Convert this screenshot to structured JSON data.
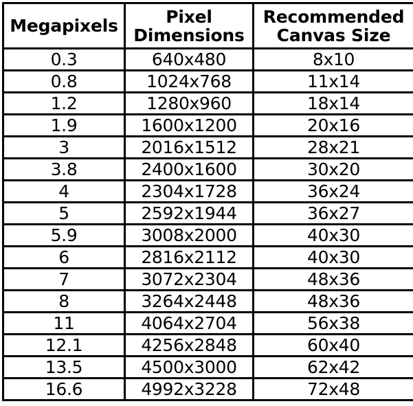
{
  "table": {
    "columns": [
      {
        "key": "megapixels",
        "lines": [
          "Megapixels"
        ]
      },
      {
        "key": "pixel_dimensions",
        "lines": [
          "Pixel",
          "Dimensions"
        ]
      },
      {
        "key": "canvas_size",
        "lines": [
          "Recommended",
          "Canvas Size"
        ]
      }
    ],
    "rows": [
      {
        "megapixels": "0.3",
        "pixel_dimensions": "640x480",
        "canvas_size": "8x10"
      },
      {
        "megapixels": "0.8",
        "pixel_dimensions": "1024x768",
        "canvas_size": "11x14"
      },
      {
        "megapixels": "1.2",
        "pixel_dimensions": "1280x960",
        "canvas_size": "18x14"
      },
      {
        "megapixels": "1.9",
        "pixel_dimensions": "1600x1200",
        "canvas_size": "20x16"
      },
      {
        "megapixels": "3",
        "pixel_dimensions": "2016x1512",
        "canvas_size": "28x21"
      },
      {
        "megapixels": "3.8",
        "pixel_dimensions": "2400x1600",
        "canvas_size": "30x20"
      },
      {
        "megapixels": "4",
        "pixel_dimensions": "2304x1728",
        "canvas_size": "36x24"
      },
      {
        "megapixels": "5",
        "pixel_dimensions": "2592x1944",
        "canvas_size": "36x27"
      },
      {
        "megapixels": "5.9",
        "pixel_dimensions": "3008x2000",
        "canvas_size": "40x30"
      },
      {
        "megapixels": "6",
        "pixel_dimensions": "2816x2112",
        "canvas_size": "40x30"
      },
      {
        "megapixels": "7",
        "pixel_dimensions": "3072x2304",
        "canvas_size": "48x36"
      },
      {
        "megapixels": "8",
        "pixel_dimensions": "3264x2448",
        "canvas_size": "48x36"
      },
      {
        "megapixels": "11",
        "pixel_dimensions": "4064x2704",
        "canvas_size": "56x38"
      },
      {
        "megapixels": "12.1",
        "pixel_dimensions": "4256x2848",
        "canvas_size": "60x40"
      },
      {
        "megapixels": "13.5",
        "pixel_dimensions": "4500x3000",
        "canvas_size": "62x42"
      },
      {
        "megapixels": "16.6",
        "pixel_dimensions": "4992x3228",
        "canvas_size": "72x48"
      }
    ]
  },
  "colors": {
    "border": "#000000",
    "background": "#ffffff",
    "text": "#000000"
  }
}
